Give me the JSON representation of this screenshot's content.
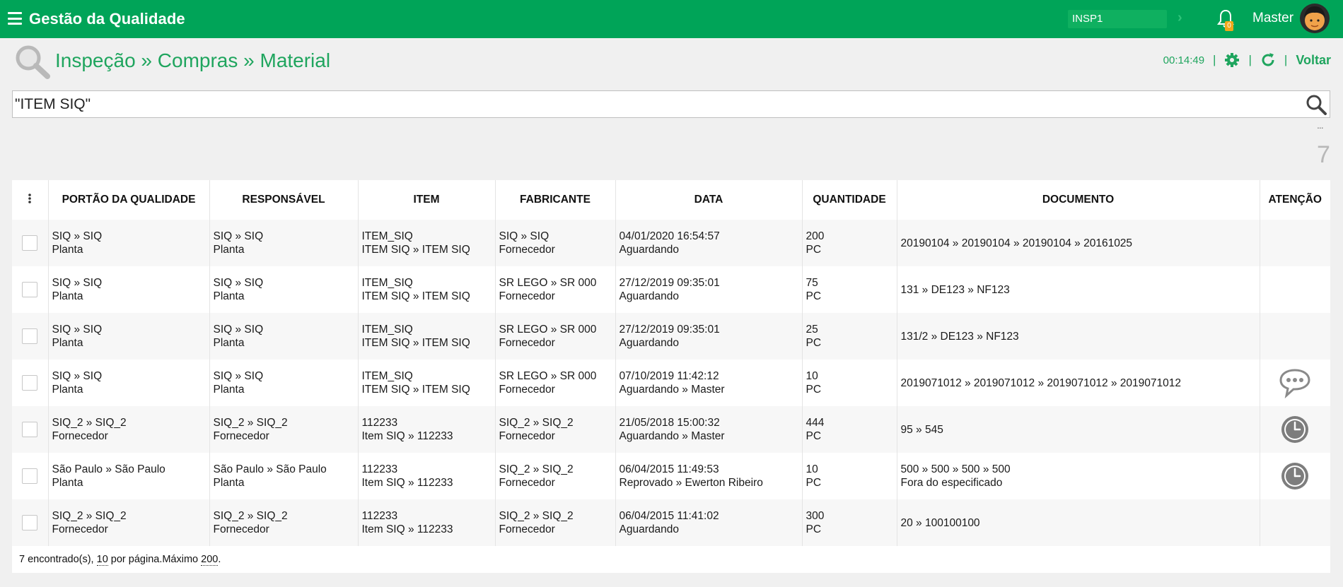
{
  "app": {
    "title": "Gestão da Qualidade",
    "workspace": "INSP1",
    "notifications": "0",
    "user": "Master"
  },
  "header": {
    "title": "Inspeção » Compras » Material",
    "timer": "00:14:49",
    "sep1": "|",
    "sep2": "|",
    "sep3": "|",
    "back": "Voltar"
  },
  "search": {
    "value": "\"ITEM SIQ\"",
    "ellipsis": "...",
    "result_count": "7"
  },
  "table": {
    "columns": [
      "PORTÃO DA QUALIDADE",
      "RESPONSÁVEL",
      "ITEM",
      "FABRICANTE",
      "DATA",
      "QUANTIDADE",
      "DOCUMENTO",
      "ATENÇÃO"
    ],
    "rows": [
      {
        "portao": [
          "SIQ » SIQ",
          "Planta"
        ],
        "resp": [
          "SIQ » SIQ",
          "Planta"
        ],
        "item": [
          "ITEM_SIQ",
          "ITEM SIQ » ITEM SIQ"
        ],
        "fab": [
          "SIQ » SIQ",
          "Fornecedor"
        ],
        "data": [
          "04/01/2020 16:54:57",
          "Aguardando"
        ],
        "qtd": [
          "200",
          "PC"
        ],
        "doc": [
          "20190104 » 20190104 » 20190104 » 20161025",
          ""
        ],
        "attention": "none"
      },
      {
        "portao": [
          "SIQ » SIQ",
          "Planta"
        ],
        "resp": [
          "SIQ » SIQ",
          "Planta"
        ],
        "item": [
          "ITEM_SIQ",
          "ITEM SIQ » ITEM SIQ"
        ],
        "fab": [
          "SR LEGO » SR 000",
          "Fornecedor"
        ],
        "data": [
          "27/12/2019 09:35:01",
          "Aguardando"
        ],
        "qtd": [
          "75",
          "PC"
        ],
        "doc": [
          "131 » DE123 » NF123",
          ""
        ],
        "attention": "none"
      },
      {
        "portao": [
          "SIQ » SIQ",
          "Planta"
        ],
        "resp": [
          "SIQ » SIQ",
          "Planta"
        ],
        "item": [
          "ITEM_SIQ",
          "ITEM SIQ » ITEM SIQ"
        ],
        "fab": [
          "SR LEGO » SR 000",
          "Fornecedor"
        ],
        "data": [
          "27/12/2019 09:35:01",
          "Aguardando"
        ],
        "qtd": [
          "25",
          "PC"
        ],
        "doc": [
          "131/2 » DE123 » NF123",
          ""
        ],
        "attention": "none"
      },
      {
        "portao": [
          "SIQ » SIQ",
          "Planta"
        ],
        "resp": [
          "SIQ » SIQ",
          "Planta"
        ],
        "item": [
          "ITEM_SIQ",
          "ITEM SIQ » ITEM SIQ"
        ],
        "fab": [
          "SR LEGO » SR 000",
          "Fornecedor"
        ],
        "data": [
          "07/10/2019 11:42:12",
          "Aguardando » Master"
        ],
        "qtd": [
          "10",
          "PC"
        ],
        "doc": [
          "2019071012 » 2019071012 » 2019071012 » 2019071012",
          ""
        ],
        "attention": "chat-bubble-icon"
      },
      {
        "portao": [
          "SIQ_2 » SIQ_2",
          "Fornecedor"
        ],
        "resp": [
          "SIQ_2 » SIQ_2",
          "Fornecedor"
        ],
        "item": [
          "112233",
          "Item SIQ » 112233"
        ],
        "fab": [
          "SIQ_2 » SIQ_2",
          "Fornecedor"
        ],
        "data": [
          "21/05/2018 15:00:32",
          "Aguardando » Master"
        ],
        "qtd": [
          "444",
          "PC"
        ],
        "doc": [
          "95 » 545",
          ""
        ],
        "attention": "clock-icon"
      },
      {
        "portao": [
          "São Paulo » São Paulo",
          "Planta"
        ],
        "resp": [
          "São Paulo » São Paulo",
          "Planta"
        ],
        "item": [
          "112233",
          "Item SIQ » 112233"
        ],
        "fab": [
          "SIQ_2 » SIQ_2",
          "Fornecedor"
        ],
        "data": [
          "06/04/2015 11:49:53",
          "Reprovado » Ewerton Ribeiro"
        ],
        "qtd": [
          "10",
          "PC"
        ],
        "doc": [
          "500 » 500 » 500 » 500",
          "Fora do especificado"
        ],
        "attention": "clock-icon"
      },
      {
        "portao": [
          "SIQ_2 » SIQ_2",
          "Fornecedor"
        ],
        "resp": [
          "SIQ_2 » SIQ_2",
          "Fornecedor"
        ],
        "item": [
          "112233",
          "Item SIQ » 112233"
        ],
        "fab": [
          "SIQ_2 » SIQ_2",
          "Fornecedor"
        ],
        "data": [
          "06/04/2015 11:41:02",
          "Aguardando"
        ],
        "qtd": [
          "300",
          "PC"
        ],
        "doc": [
          "20 » 100100100",
          ""
        ],
        "attention": "none"
      }
    ]
  },
  "footer": {
    "found": "7 encontrado(s), ",
    "per_page": "10",
    "per_page_label": " por página.Máximo ",
    "max": "200",
    "end": "."
  },
  "colors": {
    "brand_green": "#00a458",
    "title_green": "#1fa55e",
    "badge_orange": "#f1a81a",
    "icon_gray": "#7d7d7d"
  }
}
